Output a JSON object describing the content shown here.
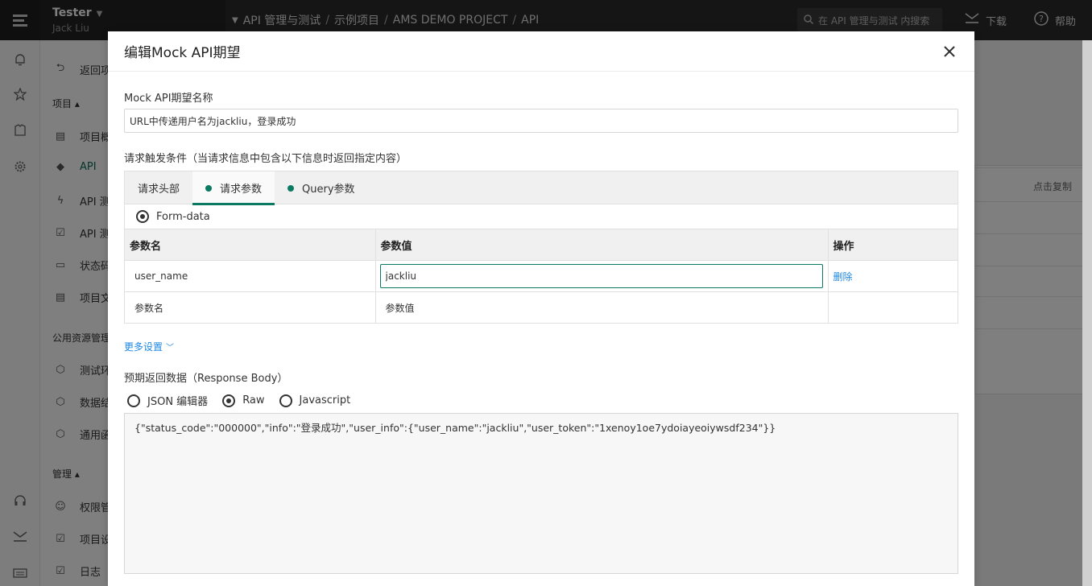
{
  "topbar": {
    "user_name": "Tester",
    "user_sub": "Jack Liu",
    "breadcrumb": [
      "API 管理与测试",
      "示例项目",
      "AMS DEMO PROJECT",
      "API"
    ],
    "search_placeholder": "在 API 管理与测试 内搜索",
    "download_label": "下载",
    "help_label": "帮助"
  },
  "sidebar": {
    "back_label": "返回项",
    "group_project": "项目",
    "items_project": [
      "项目概",
      "API",
      "API 测",
      "API 测",
      "状态码",
      "项目文"
    ],
    "group_public": "公用资源管理",
    "items_public": [
      "测试环",
      "数据结",
      "通用函"
    ],
    "group_manage": "管理",
    "items_manage": [
      "权限管",
      "项目设",
      "日志"
    ]
  },
  "background": {
    "copy_label": "点击复制"
  },
  "modal": {
    "title": "编辑Mock API期望",
    "name_label": "Mock API期望名称",
    "name_value": "URL中传递用户名为jackliu，登录成功",
    "condition_label": "请求触发条件（当请求信息中包含以下信息时返回指定内容）",
    "tabs": [
      {
        "label": "请求头部",
        "dot": false,
        "active": false
      },
      {
        "label": "请求参数",
        "dot": true,
        "active": true
      },
      {
        "label": "Query参数",
        "dot": true,
        "active": false
      }
    ],
    "form_type": "Form-data",
    "table": {
      "headers": [
        "参数名",
        "参数值",
        "操作"
      ],
      "row": {
        "name": "user_name",
        "value": "jackliu",
        "action": "删除"
      },
      "placeholder_name": "参数名",
      "placeholder_value": "参数值"
    },
    "more_settings": "更多设置",
    "response_label": "预期返回数据（Response Body）",
    "response_options": [
      {
        "label": "JSON 编辑器",
        "checked": false
      },
      {
        "label": "Raw",
        "checked": true
      },
      {
        "label": "Javascript",
        "checked": false
      }
    ],
    "response_body": "{\"status_code\":\"000000\",\"info\":\"登录成功\",\"user_info\":{\"user_name\":\"jackliu\",\"user_token\":\"1xenoy1oe7ydoiayeoiywsdf234\"}}"
  }
}
